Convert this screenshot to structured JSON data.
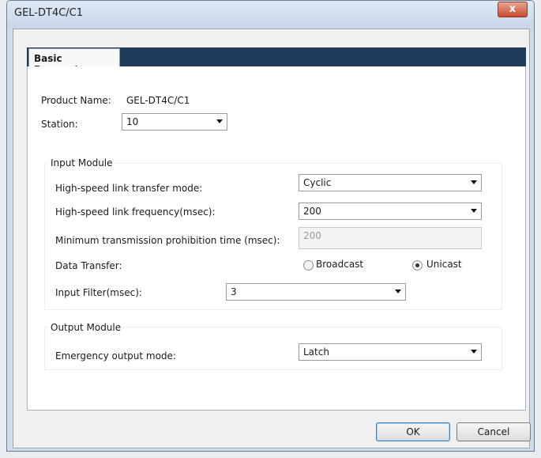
{
  "window": {
    "title": "GEL-DT4C/C1",
    "close_glyph": "x"
  },
  "tabs": [
    {
      "label": "Basic Parameter"
    }
  ],
  "product": {
    "label": "Product Name:",
    "value": "GEL-DT4C/C1"
  },
  "station": {
    "label": "Station:",
    "value": "10"
  },
  "input_module": {
    "title": "Input Module",
    "hs_transfer_mode": {
      "label": "High-speed link transfer mode:",
      "value": "Cyclic"
    },
    "hs_frequency": {
      "label": "High-speed link frequency(msec):",
      "value": "200"
    },
    "min_prohibition": {
      "label": "Minimum transmission prohibition time (msec):",
      "value": "200"
    },
    "data_transfer": {
      "label": "Data Transfer:",
      "options": [
        "Broadcast",
        "Unicast"
      ],
      "selected": "Unicast"
    },
    "input_filter": {
      "label": "Input Filter(msec):",
      "value": "3"
    }
  },
  "output_module": {
    "title": "Output Module",
    "emergency_mode": {
      "label": "Emergency output mode:",
      "value": "Latch"
    }
  },
  "buttons": {
    "ok": "OK",
    "cancel": "Cancel"
  }
}
